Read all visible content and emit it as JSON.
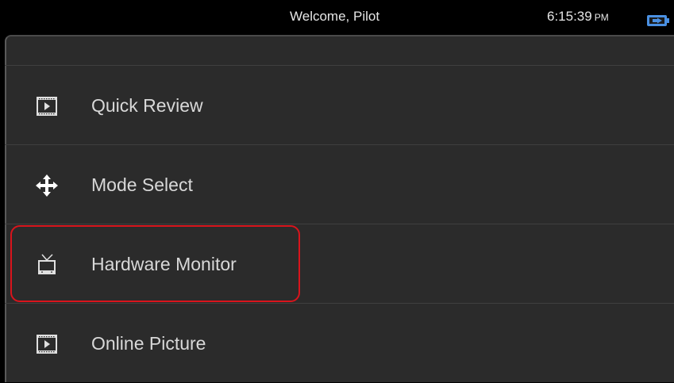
{
  "status_bar": {
    "title": "Welcome, Pilot",
    "time": "6:15:39",
    "ampm": "PM"
  },
  "menu": {
    "items": [
      {
        "label": "Quick Review",
        "icon": "film-icon"
      },
      {
        "label": "Mode Select",
        "icon": "move-arrows-icon"
      },
      {
        "label": "Hardware Monitor",
        "icon": "tv-icon",
        "highlighted": true
      },
      {
        "label": "Online Picture",
        "icon": "film-icon"
      }
    ]
  },
  "colors": {
    "highlight": "#d9141c",
    "panel": "#2b2b2b",
    "battery": "#4a90e2"
  }
}
